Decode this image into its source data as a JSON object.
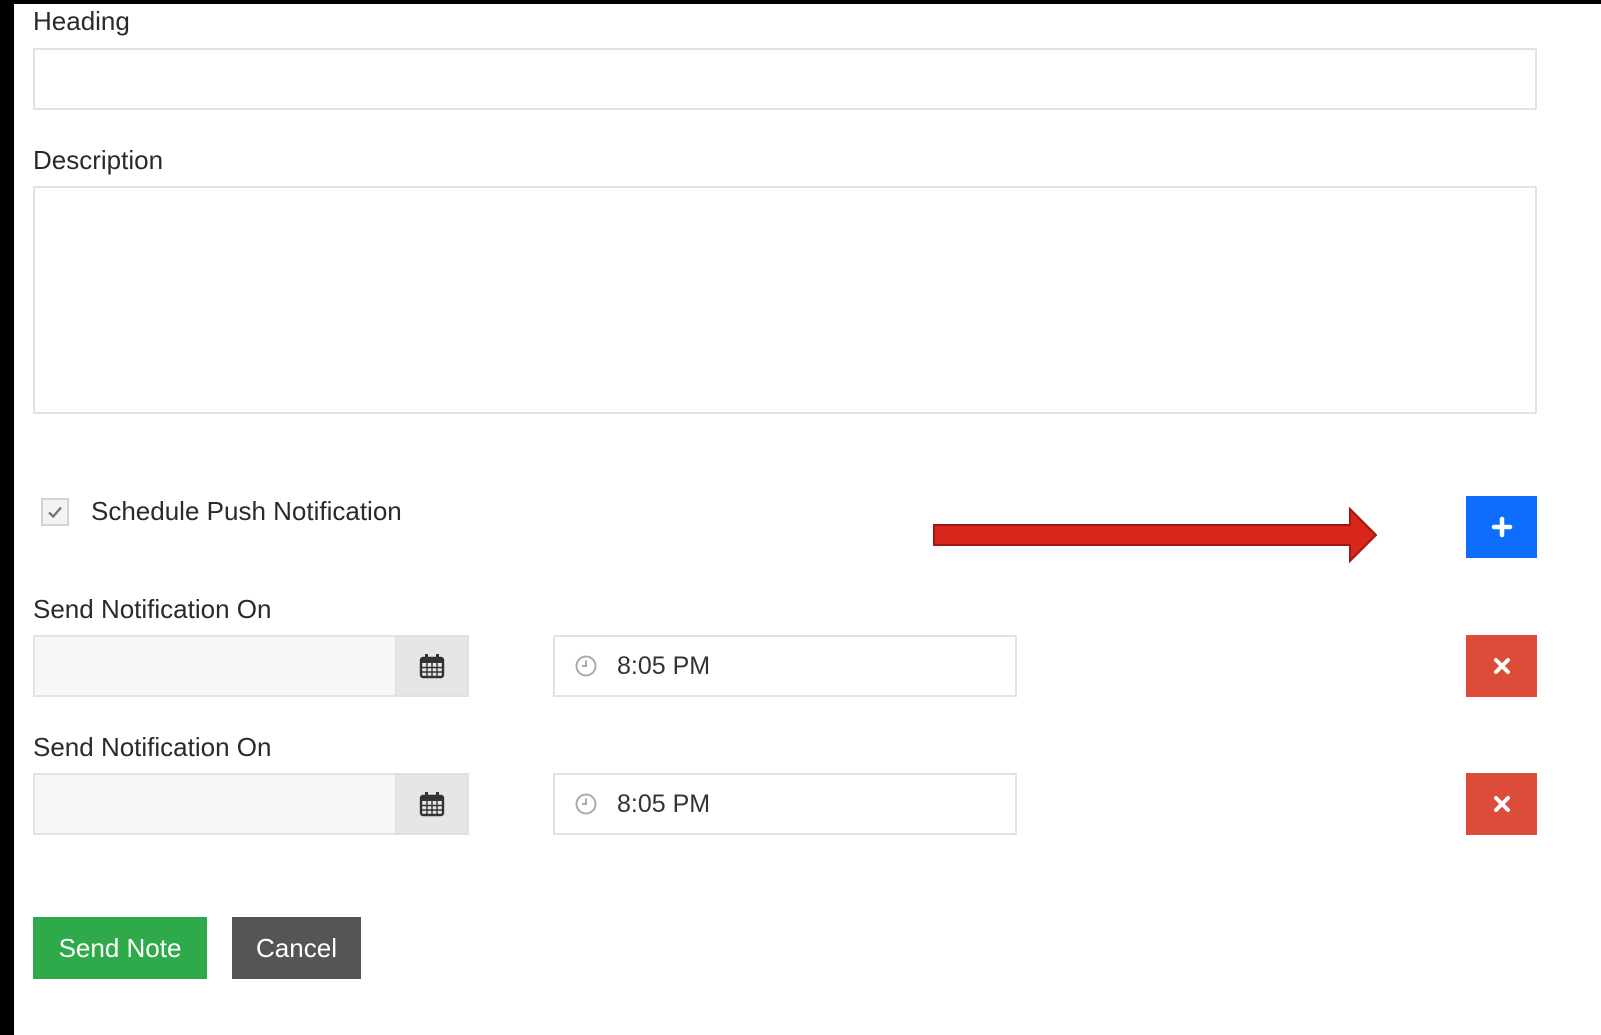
{
  "form": {
    "heading_label": "Heading",
    "heading_value": "",
    "description_label": "Description",
    "description_value": "",
    "schedule_label": "Schedule Push Notification",
    "schedule_checked": true,
    "notifications": [
      {
        "label": "Send Notification On",
        "date_value": "",
        "time_value": "8:05 PM"
      },
      {
        "label": "Send Notification On",
        "date_value": "",
        "time_value": "8:05 PM"
      }
    ],
    "send_label": "Send Note",
    "cancel_label": "Cancel"
  },
  "icons": {
    "add": "plus-icon",
    "remove": "times-icon",
    "calendar": "calendar-icon",
    "clock": "clock-icon",
    "check": "check-icon",
    "annotation": "red-arrow-annotation"
  },
  "colors": {
    "add_button": "#0d6efd",
    "remove_button": "#dd4b39",
    "send_button": "#2eaa4a",
    "cancel_button": "#555555",
    "annotation_arrow": "#d9261c"
  }
}
